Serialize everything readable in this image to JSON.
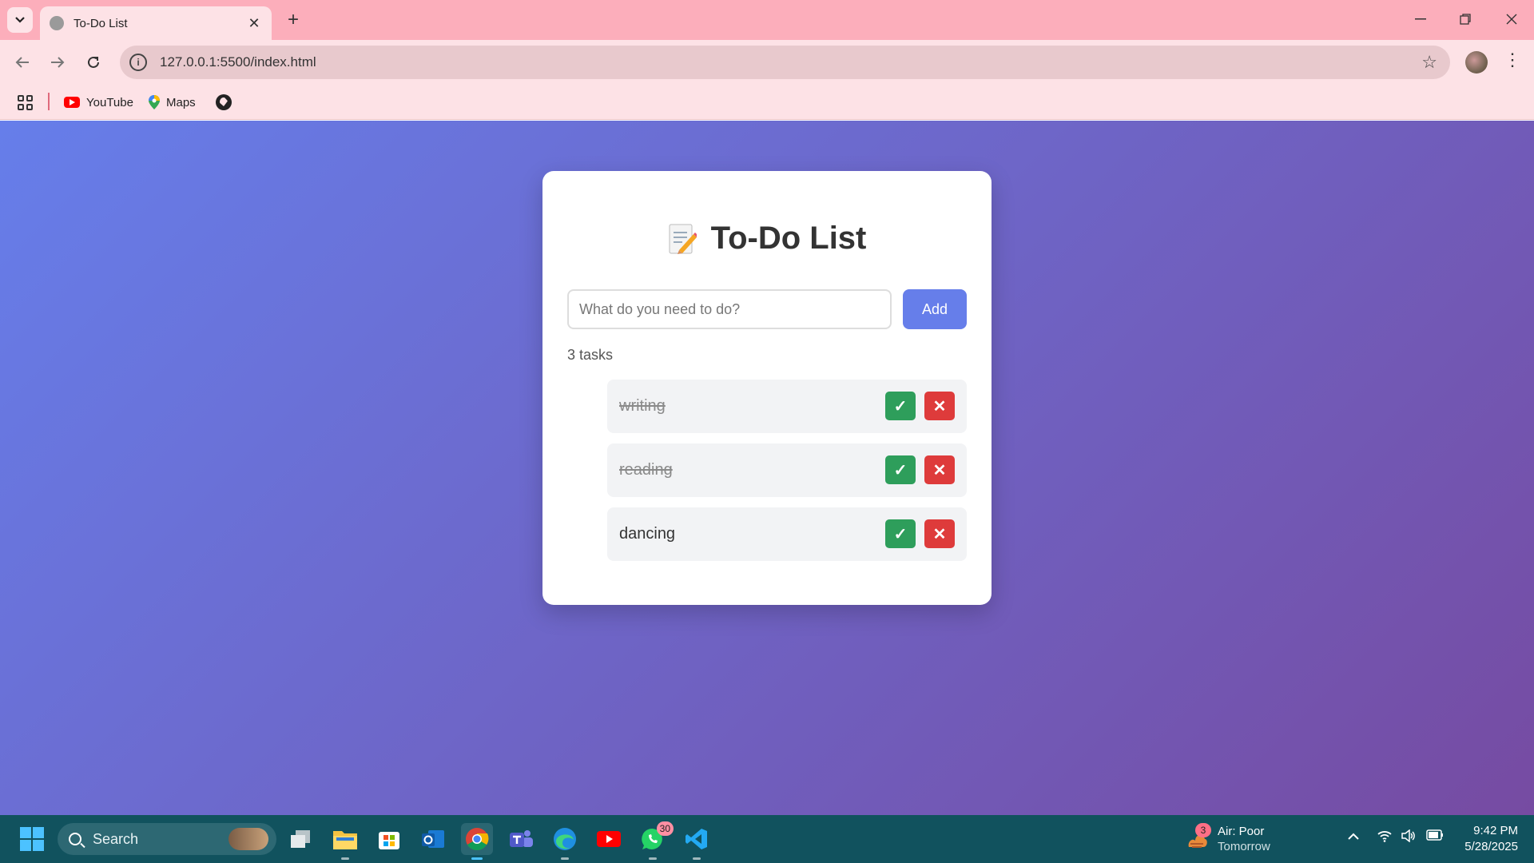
{
  "browser": {
    "tab_title": "To-Do List",
    "url": "127.0.0.1:5500/index.html",
    "bookmarks": [
      {
        "label": "YouTube",
        "icon": "youtube-icon"
      },
      {
        "label": "Maps",
        "icon": "maps-icon"
      }
    ]
  },
  "app": {
    "title": "To-Do List",
    "title_icon": "memo-icon",
    "input_placeholder": "What do you need to do?",
    "add_label": "Add",
    "task_count": "3 tasks",
    "done_symbol": "✓",
    "delete_symbol": "✕",
    "tasks": [
      {
        "text": "writing",
        "completed": true
      },
      {
        "text": "reading",
        "completed": true
      },
      {
        "text": "dancing",
        "completed": false
      }
    ],
    "colors": {
      "gradient_start": "#667eea",
      "gradient_end": "#764ba2",
      "done_button": "#2e9e5b",
      "delete_button": "#de3b3b",
      "add_button": "#667eea"
    }
  },
  "taskbar": {
    "search_label": "Search",
    "whatsapp_badge": "30",
    "weather_badge": "3",
    "weather_title": "Air: Poor",
    "weather_sub": "Tomorrow",
    "time": "9:42 PM",
    "date": "5/28/2025"
  }
}
